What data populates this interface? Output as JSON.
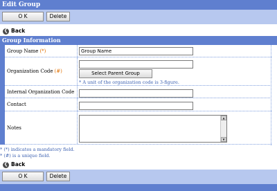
{
  "window": {
    "title": "Edit Group"
  },
  "actions": {
    "ok_label": "O K",
    "delete_label": "Delete",
    "back_label": "Back"
  },
  "section": {
    "title": "Group Information"
  },
  "form": {
    "group_name": {
      "label": "Group Name",
      "mark": "(*)",
      "value": "Group Name"
    },
    "org_code": {
      "label": "Organization Code",
      "mark": "(#)",
      "value": "",
      "select_button": "Select Parent Group",
      "hint": "* A unit of the organization code is 3-figure."
    },
    "internal_code": {
      "label": "Internal Organization Code",
      "value": ""
    },
    "contact": {
      "label": "Contact",
      "value": ""
    },
    "notes": {
      "label": "Notes",
      "value": ""
    }
  },
  "legend": {
    "mandatory": "* (*) indicates a mandatory field.",
    "unique": "* (#) is a unique field."
  },
  "colors": {
    "header": "#5f7fcf",
    "button_bar": "#b7c8ef",
    "mark": "#e07000",
    "hint": "#3a5fb0"
  },
  "icons": {
    "back": "back-arrow-circle-icon",
    "scroll_up": "scroll-up-arrow-icon",
    "scroll_down": "scroll-down-arrow-icon"
  }
}
